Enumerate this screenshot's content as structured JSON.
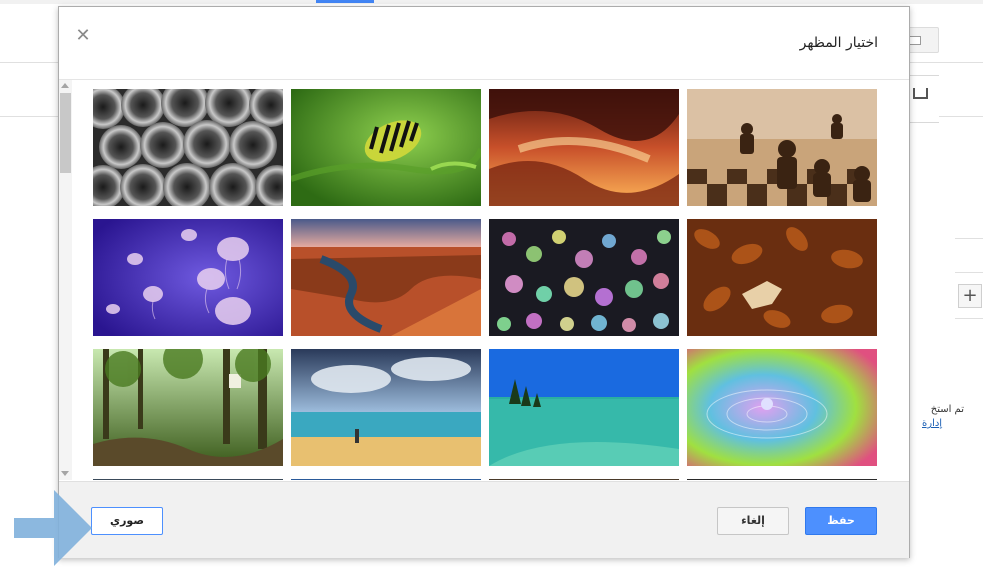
{
  "dialog": {
    "title": "اختيار المظهر",
    "close_icon": "close-icon",
    "save_label": "حفظ",
    "cancel_label": "إلغاء",
    "photos_label": "صوري"
  },
  "themes": [
    {
      "name": "pipes"
    },
    {
      "name": "caterpillar"
    },
    {
      "name": "canyon"
    },
    {
      "name": "chess"
    },
    {
      "name": "jellyfish"
    },
    {
      "name": "river-canyon"
    },
    {
      "name": "bokeh"
    },
    {
      "name": "autumn-leaves"
    },
    {
      "name": "forest"
    },
    {
      "name": "beach"
    },
    {
      "name": "lake"
    },
    {
      "name": "water-drop"
    }
  ],
  "background": {
    "partial_text": "تم استخ",
    "partial_link": "إدارة"
  },
  "colors": {
    "primary_button": "#4d90fe",
    "annotation_arrow": "#7fb0dc"
  }
}
